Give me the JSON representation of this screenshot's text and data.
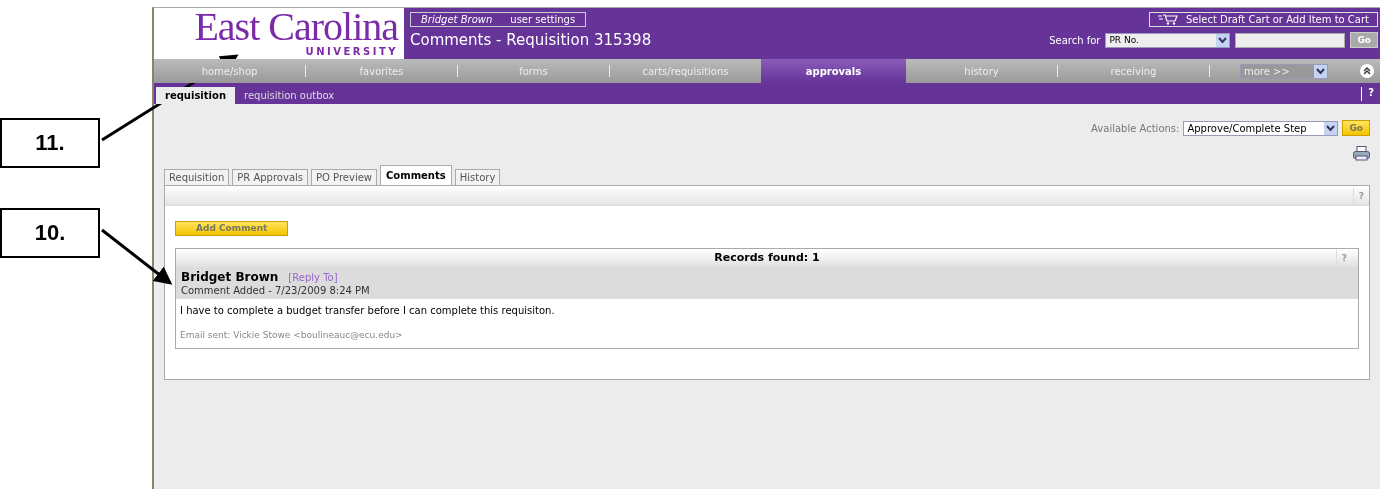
{
  "callouts": [
    {
      "label": "11."
    },
    {
      "label": "10."
    }
  ],
  "logo": {
    "name": "East Carolina",
    "sub": "UNIVERSITY"
  },
  "user": {
    "name": "Bridget Brown",
    "settings": "user settings"
  },
  "page_title": "Comments - Requisition 315398",
  "cart_button": "Select Draft Cart or Add Item to Cart",
  "search": {
    "label": "Search for",
    "type": "PR No.",
    "button": "Go"
  },
  "nav": [
    {
      "label": "home/shop",
      "selected": false
    },
    {
      "label": "favorites",
      "selected": false
    },
    {
      "label": "forms",
      "selected": false
    },
    {
      "label": "carts/requisitions",
      "selected": false
    },
    {
      "label": "approvals",
      "selected": true
    },
    {
      "label": "history",
      "selected": false
    },
    {
      "label": "receiving",
      "selected": false
    }
  ],
  "nav_more": "more >>",
  "subtabs": [
    {
      "label": "requisition",
      "selected": true
    },
    {
      "label": "requisition outbox",
      "selected": false
    }
  ],
  "help": "?",
  "actions": {
    "label": "Available Actions:",
    "value": "Approve/Complete Step",
    "button": "Go"
  },
  "doc_tabs": [
    {
      "label": "Requisition",
      "selected": false
    },
    {
      "label": "PR Approvals",
      "selected": false
    },
    {
      "label": "PO Preview",
      "selected": false
    },
    {
      "label": "Comments",
      "selected": true
    },
    {
      "label": "History",
      "selected": false
    }
  ],
  "add_comment": "Add Comment",
  "records": {
    "header": "Records found: 1",
    "comments": [
      {
        "author": "Bridget Brown",
        "reply": "[Reply To]",
        "added": "Comment Added - 7/23/2009 8:24 PM",
        "text": "I have to complete a budget transfer before I can complete this requisiton.",
        "email": "Email sent: Vickie Stowe <boulineauc@ecu.edu>"
      }
    ]
  }
}
